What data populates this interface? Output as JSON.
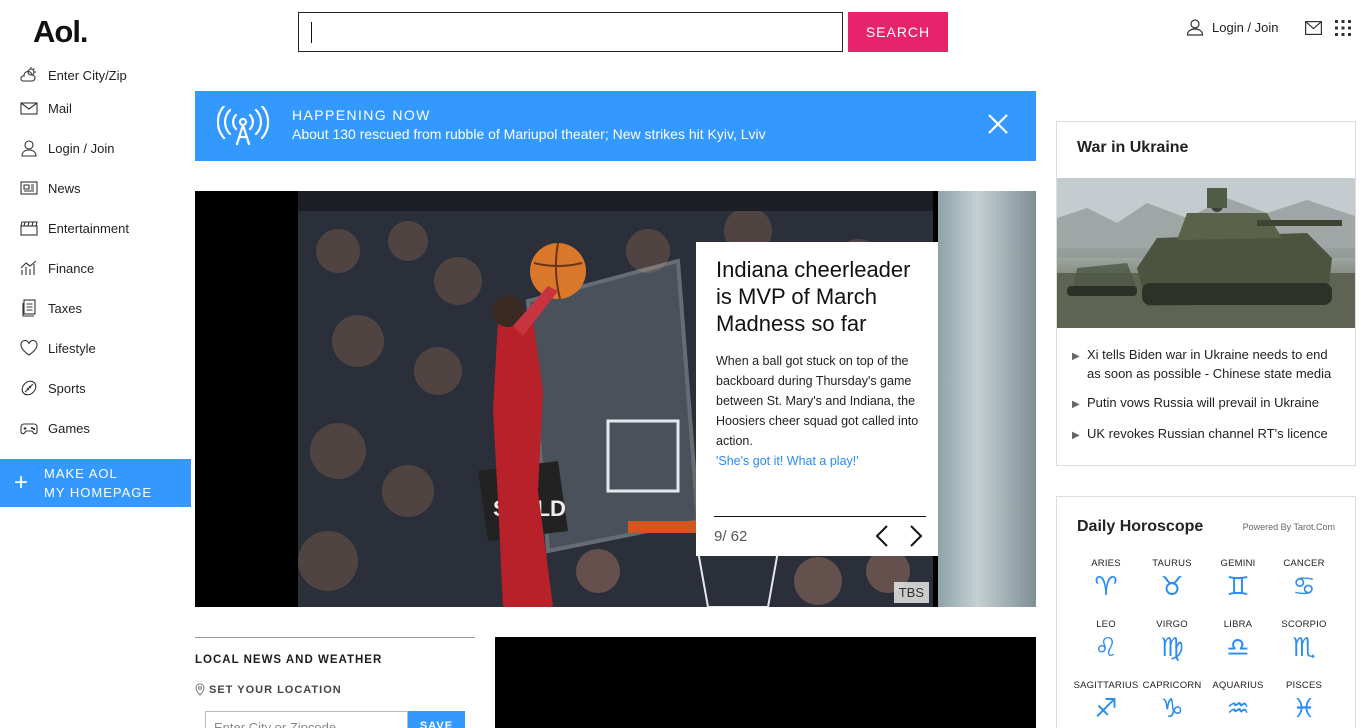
{
  "header": {
    "logo": "Aol.",
    "search_placeholder": "",
    "search_label": "SEARCH",
    "login_label": "Login / Join"
  },
  "sidebar": {
    "items": [
      {
        "label": "Enter City/Zip",
        "icon": "weather-icon"
      },
      {
        "label": "Mail",
        "icon": "mail-icon"
      },
      {
        "label": "Login / Join",
        "icon": "user-icon"
      },
      {
        "label": "News",
        "icon": "news-icon"
      },
      {
        "label": "Entertainment",
        "icon": "clapper-icon"
      },
      {
        "label": "Finance",
        "icon": "chart-icon"
      },
      {
        "label": "Taxes",
        "icon": "document-icon"
      },
      {
        "label": "Lifestyle",
        "icon": "heart-icon"
      },
      {
        "label": "Sports",
        "icon": "ball-icon"
      },
      {
        "label": "Games",
        "icon": "gamepad-icon"
      }
    ],
    "make_aol_line1": "MAKE AOL",
    "make_aol_line2": "MY HOMEPAGE"
  },
  "banner": {
    "title": "HAPPENING NOW",
    "text": "About 130 rescued from rubble of Mariupol theater; New strikes hit Kyiv, Lviv"
  },
  "hero": {
    "title": "Indiana cheerleader is MVP of March Madness so far",
    "body": "When a ball got stuck on top of the backboard during Thursday's game between St. Mary's and Indiana, the Hoosiers cheer squad got called into action.",
    "link": "'She's got it! What a play!'",
    "counter": "9/ 62",
    "credit": "TBS"
  },
  "local": {
    "title": "LOCAL NEWS AND WEATHER",
    "set_location": "SET YOUR LOCATION",
    "zip_placeholder": "Enter City or Zipcode",
    "save_label": "SAVE"
  },
  "war": {
    "title": "War in Ukraine",
    "items": [
      "Xi tells Biden war in Ukraine needs to end as soon as possible - Chinese state media",
      "Putin vows Russia will prevail in Ukraine",
      "UK revokes Russian channel RT's licence"
    ]
  },
  "horoscope": {
    "title": "Daily Horoscope",
    "powered": "Powered By Tarot.Com",
    "signs": [
      {
        "name": "ARIES",
        "glyph": "♈"
      },
      {
        "name": "TAURUS",
        "glyph": "♉"
      },
      {
        "name": "GEMINI",
        "glyph": "♊"
      },
      {
        "name": "CANCER",
        "glyph": "♋"
      },
      {
        "name": "LEO",
        "glyph": "♌"
      },
      {
        "name": "VIRGO",
        "glyph": "♍"
      },
      {
        "name": "LIBRA",
        "glyph": "♎"
      },
      {
        "name": "SCORPIO",
        "glyph": "♏"
      },
      {
        "name": "SAGITTARIUS",
        "glyph": "♐"
      },
      {
        "name": "CAPRICORN",
        "glyph": "♑"
      },
      {
        "name": "AQUARIUS",
        "glyph": "♒"
      },
      {
        "name": "PISCES",
        "glyph": "♓"
      }
    ]
  },
  "colors": {
    "accent_blue": "#3399ff",
    "search_pink": "#e5246c",
    "link_blue": "#2a8cf0"
  }
}
